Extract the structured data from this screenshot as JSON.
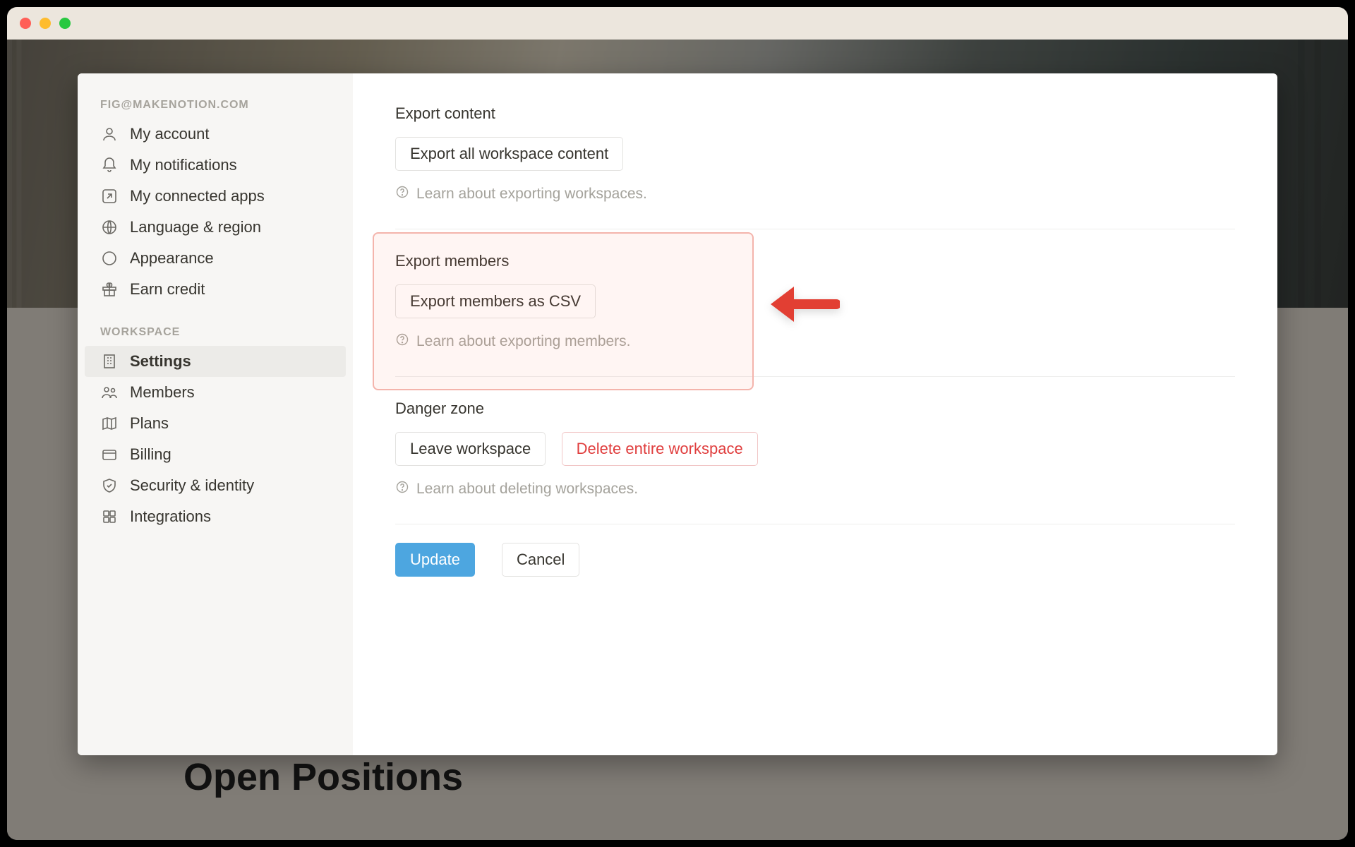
{
  "background": {
    "heading": "Open Positions"
  },
  "sidebar": {
    "account_label": "FIG@MAKENOTION.COM",
    "workspace_label": "WORKSPACE",
    "account_items": [
      {
        "label": "My account"
      },
      {
        "label": "My notifications"
      },
      {
        "label": "My connected apps"
      },
      {
        "label": "Language & region"
      },
      {
        "label": "Appearance"
      },
      {
        "label": "Earn credit"
      }
    ],
    "workspace_items": [
      {
        "label": "Settings"
      },
      {
        "label": "Members"
      },
      {
        "label": "Plans"
      },
      {
        "label": "Billing"
      },
      {
        "label": "Security & identity"
      },
      {
        "label": "Integrations"
      }
    ]
  },
  "content": {
    "export_content": {
      "title": "Export content",
      "button": "Export all workspace content",
      "hint": "Learn about exporting workspaces."
    },
    "export_members": {
      "title": "Export members",
      "button": "Export members as CSV",
      "hint": "Learn about exporting members."
    },
    "danger": {
      "title": "Danger zone",
      "leave": "Leave workspace",
      "delete": "Delete entire workspace",
      "hint": "Learn about deleting workspaces."
    }
  },
  "footer": {
    "update": "Update",
    "cancel": "Cancel"
  }
}
